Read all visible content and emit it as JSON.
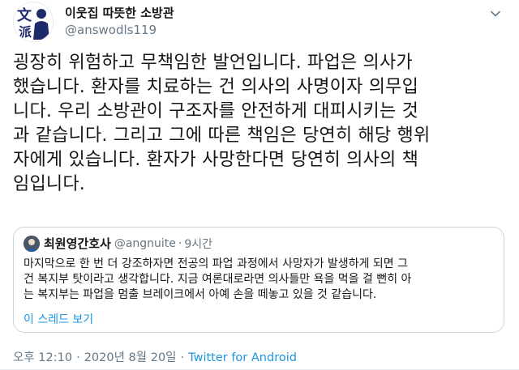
{
  "author": {
    "display_name": "이웃집 따뜻한 소방관",
    "handle": "@answodls119",
    "avatar_icon": "profile-avatar-icon"
  },
  "tweet": {
    "text": "굉장히 위험하고 무책임한 발언입니다. 파업은 의사가\n했습니다. 환자를 치료하는 건 의사의 사명이자 의무입\n니다. 우리 소방관이 구조자를 안전하게 대피시키는 것\n과 같습니다. 그리고 그에 따른 책임은 당연히 해당 행위\n자에게 있습니다. 환자가 사망한다면 당연히 의사의 책\n임입니다.",
    "more_icon": "chevron-down-icon"
  },
  "quote": {
    "display_name": "최원영간호사",
    "handle": "@angnuite",
    "separator": "·",
    "time": "9시간",
    "text": "마지막으로 한 번 더 강조하자면 전공의 파업 과정에서 사망자가 발생하게 되면 그\n건 복지부 탓이라고 생각합니다. 지금 여론대로라면 의사들만 욕을 먹을 걸 뻔히 아\n는 복지부는 파업을 멈출 브레이크에서 아예 손을 떼놓고 있을 것 같습니다.",
    "show_thread": "이 스레드 보기"
  },
  "meta": {
    "time": "오후 12:10",
    "separator": "·",
    "date": "2020년 8월 20일",
    "source": "Twitter for Android"
  },
  "colors": {
    "text": "#14171a",
    "secondary": "#657786",
    "link": "#1b95e0",
    "border": "#ccd6dd"
  }
}
